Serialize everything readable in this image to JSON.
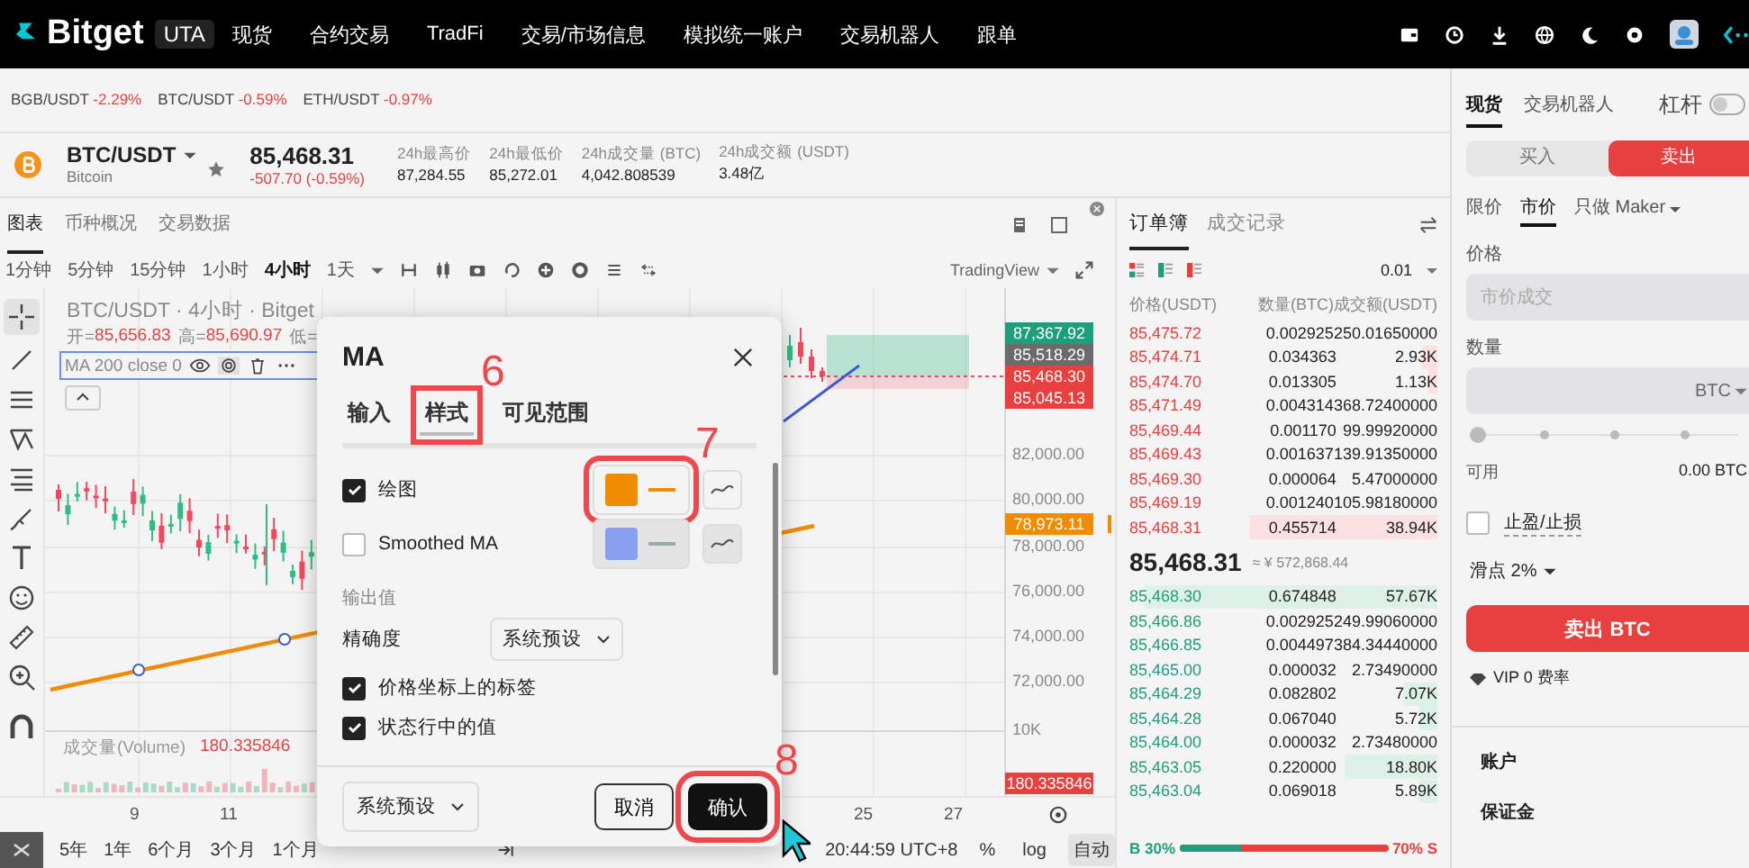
{
  "topbar": {
    "brand": "Bitget",
    "badge": "UTA",
    "nav": [
      "现货",
      "合约交易",
      "TradFi",
      "交易/市场信息",
      "模拟统一账户",
      "交易机器人",
      "跟单"
    ]
  },
  "tickers": [
    {
      "pair": "BGB/USDT",
      "change": "-2.29%"
    },
    {
      "pair": "BTC/USDT",
      "change": "-0.59%"
    },
    {
      "pair": "ETH/USDT",
      "change": "-0.97%"
    }
  ],
  "pair": {
    "symbol": "BTC/USDT",
    "name": "Bitcoin",
    "price": "85,468.31",
    "change": "-507.70 (-0.59%)",
    "stats": [
      {
        "label": "24h最高价",
        "value": "87,284.55"
      },
      {
        "label": "24h最低价",
        "value": "85,272.01"
      },
      {
        "label": "24h成交量 (BTC)",
        "value": "4,042.808539"
      },
      {
        "label": "24h成交额 (USDT)",
        "value": "3.48亿"
      }
    ]
  },
  "chart": {
    "tabs": [
      {
        "label": "图表",
        "selected": true
      },
      {
        "label": "币种概况",
        "selected": false
      },
      {
        "label": "交易数据",
        "selected": false
      }
    ],
    "intervals": [
      {
        "label": "1分钟",
        "selected": false
      },
      {
        "label": "5分钟",
        "selected": false
      },
      {
        "label": "15分钟",
        "selected": false
      },
      {
        "label": "1小时",
        "selected": false
      },
      {
        "label": "4小时",
        "selected": true
      },
      {
        "label": "1天",
        "selected": false
      }
    ],
    "source": "TradingView",
    "title": "BTC/USDT · 4小时 · Bitget",
    "ohlc": [
      {
        "label": "开=",
        "value": "85,656.83"
      },
      {
        "label": "高=",
        "value": "85,690.97"
      },
      {
        "label": "低="
      }
    ],
    "indicator": "MA 200 close 0",
    "volume_label": "成交量(Volume)",
    "volume_value": "180.335846",
    "price_ticks": [
      "82,000.00",
      "80,000.00",
      "78,000.00",
      "76,000.00",
      "74,000.00",
      "72,000.00",
      "10K"
    ],
    "price_tags": [
      {
        "value": "87,367.92",
        "color": "#1e9e7a"
      },
      {
        "value": "85,518.29",
        "color": "#6b6b6b"
      },
      {
        "value": "85,468.30",
        "color": "#e8403f"
      },
      {
        "value": "85,045.13",
        "color": "#e8403f"
      },
      {
        "value": "78,973.11",
        "color": "#f08c00"
      },
      {
        "value": "180.335846",
        "color": "#e8403f"
      }
    ],
    "dates": [
      "9",
      "11",
      "25",
      "27"
    ],
    "ranges": [
      "5年",
      "1年",
      "6个月",
      "3个月",
      "1个月"
    ],
    "clock": "20:44:59 UTC+8",
    "scales": [
      {
        "label": "%",
        "selected": false
      },
      {
        "label": "log",
        "selected": false
      },
      {
        "label": "自动",
        "selected": true
      }
    ]
  },
  "dialog": {
    "title": "MA",
    "tabs": [
      {
        "label": "输入",
        "selected": false
      },
      {
        "label": "样式",
        "selected": true,
        "callout": "6"
      },
      {
        "label": "可见范围",
        "selected": false
      }
    ],
    "plots": [
      {
        "label": "绘图",
        "checked": true,
        "color": "#f08c00",
        "callout": "7"
      },
      {
        "label": "Smoothed MA",
        "checked": false,
        "color": "#8aa0f0"
      }
    ],
    "section": "输出值",
    "precision": {
      "label": "精确度",
      "value": "系统预设"
    },
    "options": [
      {
        "label": "价格坐标上的标签",
        "checked": true
      },
      {
        "label": "状态行中的值",
        "checked": true
      }
    ],
    "preset": "系统预设",
    "cancel": "取消",
    "confirm": "确认",
    "confirm_callout": "8"
  },
  "orderbook": {
    "tabs": [
      {
        "label": "订单簿",
        "selected": true
      },
      {
        "label": "成交记录",
        "selected": false
      }
    ],
    "precision": "0.01",
    "columns": [
      "价格(USDT)",
      "数量(BTC)",
      "成交额(USDT)"
    ],
    "asks": [
      {
        "price": "85,475.72",
        "amount": "0.002925",
        "total": "250.01650000"
      },
      {
        "price": "85,474.71",
        "amount": "0.034363",
        "total": "2.93K",
        "level": 0.05
      },
      {
        "price": "85,474.70",
        "amount": "0.013305",
        "total": "1.13K",
        "level": 0.03
      },
      {
        "price": "85,471.49",
        "amount": "0.004314",
        "total": "368.72400000"
      },
      {
        "price": "85,469.44",
        "amount": "0.001170",
        "total": "99.99920000"
      },
      {
        "price": "85,469.43",
        "amount": "0.001637",
        "total": "139.91350000"
      },
      {
        "price": "85,469.30",
        "amount": "0.000064",
        "total": "5.47000000"
      },
      {
        "price": "85,469.19",
        "amount": "0.001240",
        "total": "105.98180000"
      },
      {
        "price": "85,468.31",
        "amount": "0.455714",
        "total": "38.94K",
        "level": 0.61
      }
    ],
    "last_price": "85,468.31",
    "last_fiat": "≈ ¥ 572,868.44",
    "bids": [
      {
        "price": "85,468.30",
        "amount": "0.674848",
        "total": "57.67K",
        "level": 0.95
      },
      {
        "price": "85,466.86",
        "amount": "0.002925",
        "total": "249.99060000"
      },
      {
        "price": "85,466.85",
        "amount": "0.004497",
        "total": "384.34440000"
      },
      {
        "price": "85,465.00",
        "amount": "0.000032",
        "total": "2.73490000"
      },
      {
        "price": "85,464.29",
        "amount": "0.082802",
        "total": "7.07K",
        "level": 0.11
      },
      {
        "price": "85,464.28",
        "amount": "0.067040",
        "total": "5.72K",
        "level": 0.06
      },
      {
        "price": "85,464.00",
        "amount": "0.000032",
        "total": "2.73480000"
      },
      {
        "price": "85,463.05",
        "amount": "0.220000",
        "total": "18.80K",
        "level": 0.3
      },
      {
        "price": "85,463.04",
        "amount": "0.069018",
        "total": "5.89K",
        "level": 0.06
      }
    ],
    "ratio": {
      "buy": "B 30%",
      "sell": "70% S",
      "level": 0.3
    }
  },
  "trade": {
    "tabs": [
      {
        "label": "现货",
        "selected": true
      },
      {
        "label": "交易机器人",
        "selected": false
      }
    ],
    "margin": {
      "label": "杠杆",
      "on": false
    },
    "sides": [
      {
        "label": "买入",
        "selected": false
      },
      {
        "label": "卖出",
        "selected": true
      }
    ],
    "order_types": [
      {
        "label": "限价",
        "selected": false
      },
      {
        "label": "市价",
        "selected": true
      },
      {
        "label": "只做 Maker",
        "selected": false
      }
    ],
    "price": {
      "label": "价格",
      "placeholder": "市价成交"
    },
    "amount": {
      "label": "数量",
      "unit": "BTC"
    },
    "slider": {
      "level": 0
    },
    "available": {
      "label": "可用",
      "value": "0.00 BTC"
    },
    "tpsl": {
      "label": "止盈/止损",
      "checked": false
    },
    "slippage": "滑点 2%",
    "submit": "卖出 BTC",
    "fee": "VIP 0 费率",
    "account": {
      "title": "账户",
      "margin": "保证金"
    }
  }
}
